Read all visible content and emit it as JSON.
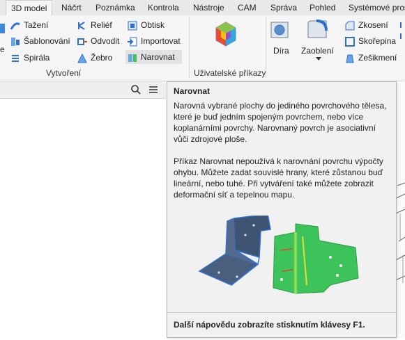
{
  "tabs": [
    {
      "label": "3D model",
      "active": true
    },
    {
      "label": "Náčrt"
    },
    {
      "label": "Poznámka"
    },
    {
      "label": "Kontrola"
    },
    {
      "label": "Nástroje"
    },
    {
      "label": "CAM"
    },
    {
      "label": "Správa"
    },
    {
      "label": "Pohled"
    },
    {
      "label": "Systémové pros"
    }
  ],
  "ribbon": {
    "create_group": {
      "label": "Vytvoření",
      "col1": [
        "Tažení",
        "Šablonování",
        "Spirála"
      ],
      "col2": [
        "Reliéf",
        "Odvodit",
        "Žebro"
      ],
      "col3": [
        "Obtisk",
        "Importovat",
        "Narovnat"
      ],
      "partial_label": "e"
    },
    "user_commands": {
      "label": "Uživatelské příkazy"
    },
    "modify": {
      "hole": "Díra",
      "fillet": "Zaoblení",
      "small": [
        "Zkosení",
        "Skořepina",
        "Zešikmení"
      ]
    }
  },
  "icons": {
    "search": "search-icon",
    "menu": "hamburger-menu-icon"
  },
  "tooltip": {
    "title": "Narovnat",
    "para1": "Narovná vybrané plochy do jediného povrchového tělesa, které je buď jedním spojeným povrchem, nebo více koplanárními povrchy. Narovnaný povrch je asociativní vůči zdrojové ploše.",
    "para2": "Příkaz Narovnat nepoužívá k narovnání povrchu výpočty ohybu. Můžete zadat souvislé hrany, které zůstanou buď lineární, nebo tuhé. Při vytváření také můžete zobrazit deformační síť a tepelnou mapu.",
    "footer": "Další nápovědu zobrazíte stisknutím klávesy F1."
  },
  "colors": {
    "accent_blue": "#2e6fd0",
    "heat_green": "#3cc45a"
  }
}
